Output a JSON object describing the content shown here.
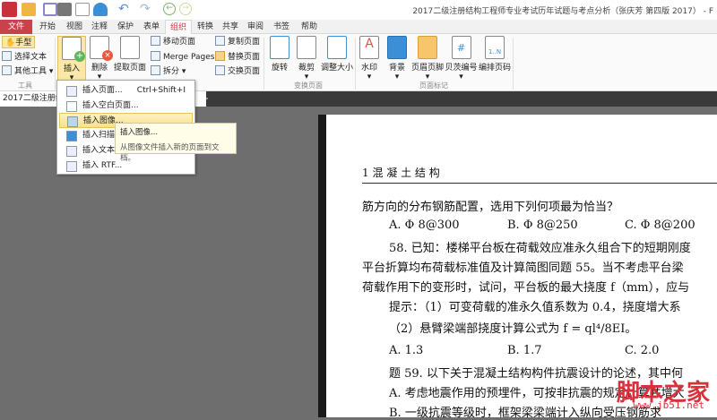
{
  "window": {
    "title": "2017二级注册结构工程师专业考试历年试题与考点分析（张庆芳 第四版 2017） - F"
  },
  "ribbon_tabs": [
    "文件",
    "开始",
    "视图",
    "注释",
    "保护",
    "表单",
    "组织",
    "转换",
    "共享",
    "审阅",
    "书签",
    "帮助"
  ],
  "tools": {
    "hand": "手型",
    "select_text": "选择文本",
    "other_tools": "其他工具",
    "group": "工具"
  },
  "pages_group": {
    "insert": "插入",
    "delete": "删除",
    "extract": "提取页面",
    "move": "移动页面",
    "merge": "Merge Pages",
    "split": "拆分",
    "copy": "复制页面",
    "replace": "替换页面",
    "swap": "交换页面"
  },
  "transform": {
    "rotate": "旋转",
    "crop": "裁剪",
    "resize": "调整大小",
    "group": "变换页面"
  },
  "marks": {
    "watermark": "水印",
    "background": "背景",
    "header_footer": "页眉页脚",
    "bates": "贝茨编号",
    "page_number": "编排页码",
    "group": "页面标记"
  },
  "doc_tab": "2017二级注册结",
  "insert_menu": [
    {
      "label": "插入页面...",
      "shortcut": "Ctrl+Shift+I"
    },
    {
      "label": "插入空白页面..."
    },
    {
      "label": "插入图像..."
    },
    {
      "label": "插入扫描的"
    },
    {
      "label": "插入文本..."
    },
    {
      "label": "插入 RTF..."
    }
  ],
  "tooltip": {
    "title": "插入图像...",
    "desc": "从图像文件插入新的页面到文档。"
  },
  "page": {
    "lines": [
      "1  混 凝 土 结 构",
      "筋方向的分布钢筋配置，选用下列何项最为恰当？",
      "A. Φ 8@300",
      "B. Φ 8@250",
      "C. Φ 8@200",
      "58. 已知：楼梯平台板在荷载效应准永久组合下的短期刚度",
      "平台折算均布荷载标准值及计算简图同题 55。当不考虑平台梁",
      "荷载作用下的变形时，试问，平台板的最大挠度 f（mm），应与",
      "提示：（1）可变荷载的准永久值系数为 0.4，挠度增大系",
      "（2）悬臂梁端部挠度计算公式为 f = ql⁴/8EI。",
      "A. 1.3",
      "B. 1.7",
      "C. 2.0",
      "题 59. 以下关于混凝土结构构件抗震设计的论述，其中何",
      "A. 考虑地震作用的预埋件，可按非抗震的规定计算并增大",
      "B. 一级抗震等级时，框架梁梁端计入纵向受压钢筋求"
    ]
  },
  "watermark": {
    "text": "脚本之家",
    "url": "www.jb51.net"
  }
}
